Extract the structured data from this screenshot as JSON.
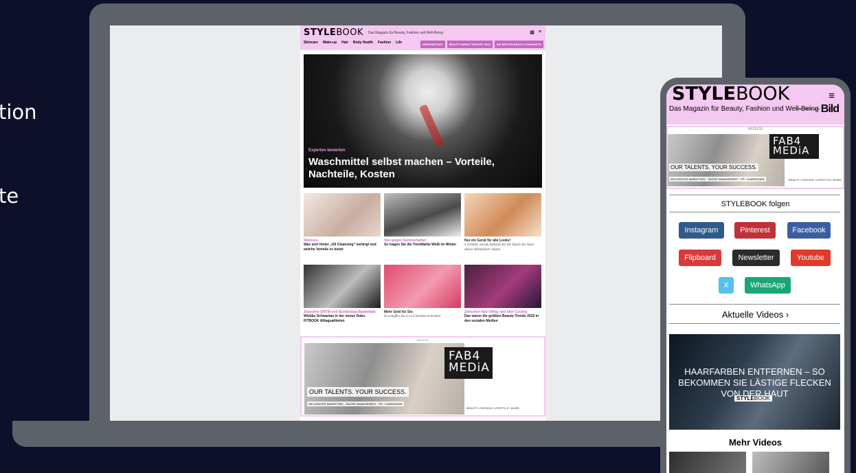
{
  "side_text": [
    "tion",
    "te"
  ],
  "laptop": {
    "logo_bold": "STYLE",
    "logo_light": "BOOK",
    "tagline": "Das Magazin für Beauty, Fashion und Well-Being",
    "header_icons": [
      "mark-icon",
      "menu-icon"
    ],
    "nav": [
      "Skincare",
      "Make-up",
      "Hair",
      "Body Health",
      "Fashion",
      "Life"
    ],
    "pills": [
      "BIRKENSTOCK",
      "BEAUTY IMPACT REPORT 2023",
      "DIE BESTEN BEAUTY-PRODUKTE"
    ],
    "hero": {
      "kicker": "Experten bewerten",
      "title": "Waschmittel selbst machen – Vorteile, Nachteile, Kosten"
    },
    "cards": [
      {
        "kicker": "Skincare",
        "text": "Was sich hinter „Oil Cleansing“ verbirgt und welche Vorteile es bietet",
        "italic": false
      },
      {
        "kicker": "Von wegen Sommerfarbe!",
        "text": "So tragen Sie die Trendfarbe Weiß im Winter",
        "italic": false
      },
      {
        "kicker": "Nur ein Gerät für alle Looks!",
        "text": "5 Gründe, warum Stylisten für die Haare der Stars diesen Alleskönner nutzen",
        "italic": true
      },
      {
        "kicker": "Zwischen GNTM und Bundesliga-Basketball",
        "text": "Wiebke Schwartau in der neuen Doku FITBOOK Alltagsathleten",
        "italic": false
      },
      {
        "kicker": "Mehr Geld für Sie:",
        "text": "So schaffen Sie es in 6 leichten Schritten!",
        "italic": true
      },
      {
        "kicker": "Zwischen Hair Oiling und Skin Cycling",
        "text": "Das waren die größten Beauty-Trends 2023 in den sozialen Medien",
        "italic": false
      }
    ],
    "ad": {
      "label": "ANZEIGE",
      "logo_line1": "FAB4",
      "logo_line2": "MEDiA",
      "slogan": "OUR TALENTS. YOUR SUCCESS.",
      "sub": "INFLUENCER MARKETING - TALENT MANAGEMENT - PR - KAMPAGNEN",
      "categories": "BEAUTY / FASHION / LIFESTYLE / MUMS"
    }
  },
  "phone": {
    "logo_bold": "STYLE",
    "logo_light": "BOOK",
    "tagline": "Das Magazin für Beauty, Fashion und Well-Being",
    "menu_icon": "≡",
    "bild_small": "Eine Marke von",
    "bild_big": "Bild",
    "ad": {
      "label": "ANZEIGE",
      "logo_line1": "FAB4",
      "logo_line2": "MEDiA",
      "slogan": "OUR TALENTS. YOUR SUCCESS.",
      "sub": "INFLUENCER MARKETING - TALENT MANAGEMENT - PR - KAMPAGNEN",
      "categories": "BEAUTY / FASHION / LIFESTYLE / MUMS"
    },
    "follow_title": "STYLEBOOK folgen",
    "social": [
      {
        "label": "Instagram",
        "color": "#2f5a8a"
      },
      {
        "label": "Pinterest",
        "color": "#c0313a"
      },
      {
        "label": "Facebook",
        "color": "#3b5ea3"
      },
      {
        "label": "Flipboard",
        "color": "#d83a3a"
      },
      {
        "label": "Newsletter",
        "color": "#2b2b2b"
      },
      {
        "label": "Youtube",
        "color": "#e03a2a"
      },
      {
        "label": "X",
        "color": "#55c0ee"
      },
      {
        "label": "WhatsApp",
        "color": "#17a776"
      }
    ],
    "videos_title": "Aktuelle Videos ›",
    "video_title": "HAARFARBEN ENTFERNEN – SO BEKOMMEN SIE LÄSTIGE FLECKEN VON DER HAUT",
    "video_brand_bold": "STYLE",
    "video_brand_light": "BOOK",
    "more_videos": "Mehr Videos"
  }
}
